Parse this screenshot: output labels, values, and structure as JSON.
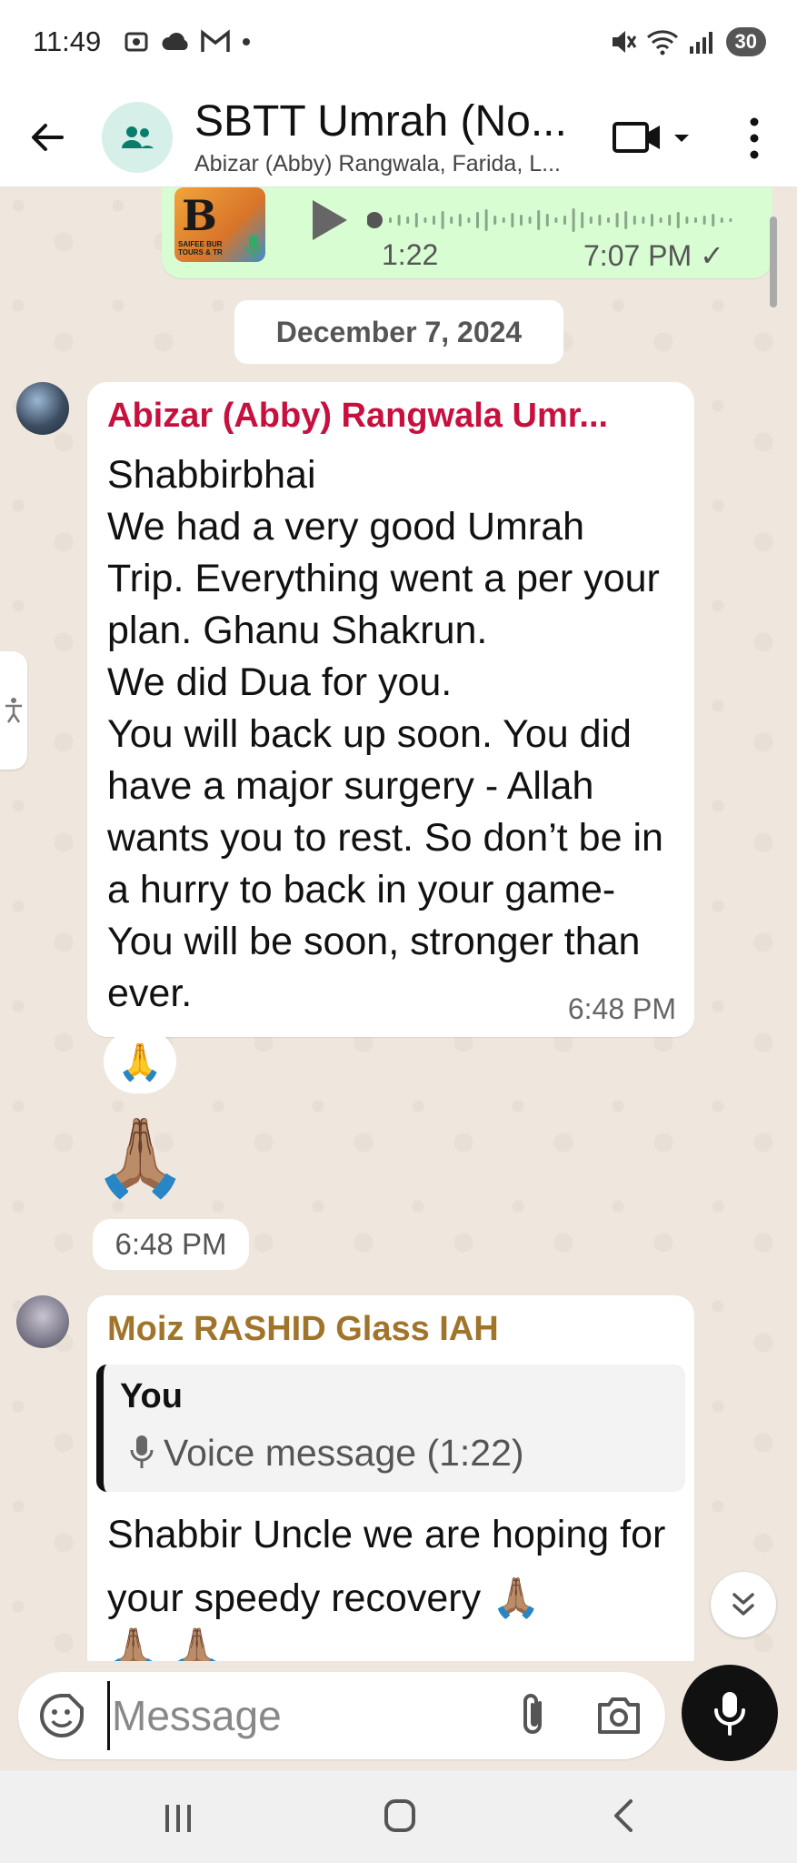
{
  "status_bar": {
    "time": "11:49",
    "battery": "30",
    "icons_left": [
      "screenshot-icon",
      "cloud-icon",
      "gmail-icon",
      "dot-icon"
    ],
    "icons_right": [
      "mute-icon",
      "wifi-icon",
      "signal-icon",
      "battery-icon"
    ]
  },
  "header": {
    "title": "SBTT Umrah (No...",
    "subtitle": "Abizar (Abby) Rangwala, Farida, L..."
  },
  "voice_message": {
    "thumbnail_text": "B",
    "thumbnail_caption": "SAIFEE BUR TOURS & TR",
    "duration": "1:22",
    "time": "7:07 PM ✓",
    "progress": 0
  },
  "date_separator": "December 7, 2024",
  "messages": [
    {
      "sender": "Abizar (Abby) Rangwala Umr...",
      "sender_color": "#c8103f",
      "text": "Shabbirbhai\nWe had a very good Umrah Trip.  Everything went a per your plan.  Ghanu Shakrun.\nWe did Dua for you.\nYou will back up soon. You did have a major surgery - Allah wants you to rest. So don’t be in a hurry to back in your game-You will be soon, stronger than ever.",
      "time": "6:48 PM",
      "reaction": "🙏"
    },
    {
      "emoji": "🙏🏽",
      "time": "6:48 PM"
    },
    {
      "sender": "Moiz RASHID Glass IAH",
      "sender_color": "#a0742a",
      "quote_author": "You",
      "quote_text": "Voice message (1:22)",
      "text": "Shabbir Uncle we are hoping for your speedy recovery 🙏🏽",
      "trailing_emoji": "🙏🏽 🙏🏽"
    }
  ],
  "composer": {
    "placeholder": "Message"
  },
  "colors": {
    "chat_bg": "#efe7de",
    "outgoing_bubble": "#d9fdd3",
    "incoming_bubble": "#ffffff",
    "accent_green": "#25d366"
  }
}
